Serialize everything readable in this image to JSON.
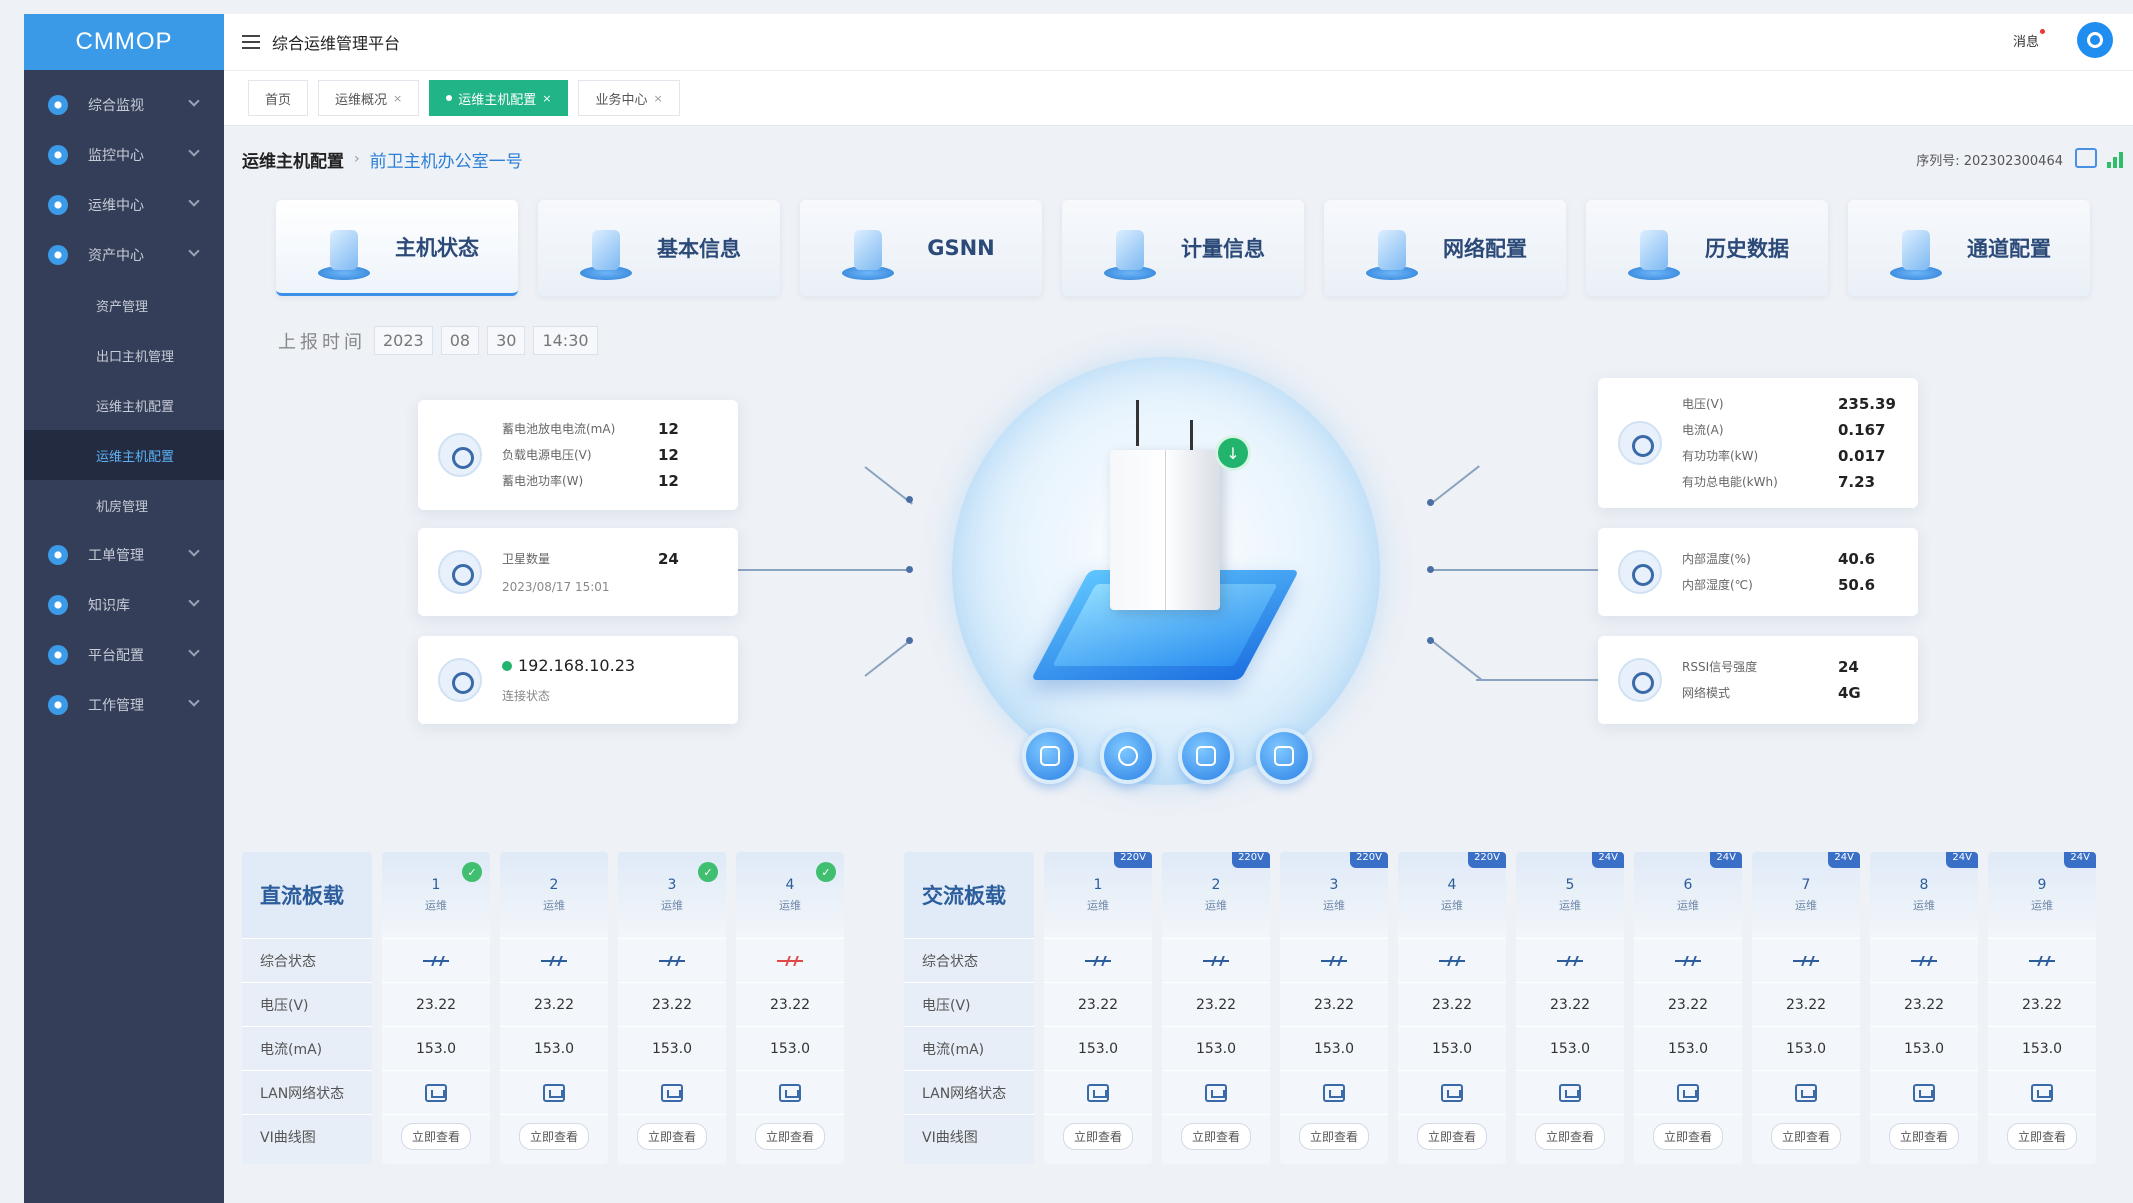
{
  "app": {
    "logo": "CMMOP",
    "platform_title": "综合运维管理平台"
  },
  "sidebar": {
    "items": [
      {
        "label": "综合监视",
        "icon": "monitor-icon"
      },
      {
        "label": "监控中心",
        "icon": "eye-icon"
      },
      {
        "label": "运维中心",
        "icon": "layers-icon"
      },
      {
        "label": "资产中心",
        "icon": "bars-icon"
      }
    ],
    "subitems": [
      {
        "label": "资产管理"
      },
      {
        "label": "出口主机管理"
      },
      {
        "label": "运维主机配置"
      },
      {
        "label": "运维主机配置",
        "active": true
      },
      {
        "label": "机房管理"
      }
    ],
    "items_after": [
      {
        "label": "工单管理",
        "icon": "gear-icon"
      },
      {
        "label": "知识库",
        "icon": "book-icon"
      },
      {
        "label": "平台配置",
        "icon": "settings-icon"
      },
      {
        "label": "工作管理",
        "icon": "work-icon"
      }
    ]
  },
  "topbar": {
    "message": "消息"
  },
  "tabs": [
    {
      "label": "首页",
      "closable": false
    },
    {
      "label": "运维概况",
      "closable": true
    },
    {
      "label": "运维主机配置",
      "closable": true,
      "active": true
    },
    {
      "label": "业务中心",
      "closable": true
    }
  ],
  "breadcrumb": {
    "main": "运维主机配置",
    "link": "前卫主机办公室一号"
  },
  "serial": {
    "label": "序列号:",
    "value": "202302300464"
  },
  "function_tabs": [
    {
      "label": "主机状态",
      "active": true
    },
    {
      "label": "基本信息"
    },
    {
      "label": "GSNN"
    },
    {
      "label": "计量信息"
    },
    {
      "label": "网络配置"
    },
    {
      "label": "历史数据"
    },
    {
      "label": "通道配置"
    }
  ],
  "report_time": {
    "label": "上报时间",
    "year": "2023",
    "month": "08",
    "day": "30",
    "time": "14:30"
  },
  "left_cards": {
    "power": {
      "rows": [
        {
          "k": "蓄电池放电电流(mA)",
          "v": "12"
        },
        {
          "k": "负载电源电压(V)",
          "v": "12"
        },
        {
          "k": "蓄电池功率(W)",
          "v": "12"
        }
      ]
    },
    "module": {
      "rows": [
        {
          "k": "卫星数量",
          "v": "24"
        }
      ],
      "sub": "2023/08/17 15:01"
    },
    "network": {
      "ip": "192.168.10.23",
      "sub": "连接状态"
    }
  },
  "right_cards": {
    "meter": {
      "rows": [
        {
          "k": "电压(V)",
          "v": "235.39"
        },
        {
          "k": "电流(A)",
          "v": "0.167"
        },
        {
          "k": "有功功率(kW)",
          "v": "0.017"
        },
        {
          "k": "有功总电能(kWh)",
          "v": "7.23"
        }
      ]
    },
    "env": {
      "rows": [
        {
          "k": "内部温度(%)",
          "v": "40.6"
        },
        {
          "k": "内部湿度(℃)",
          "v": "50.6"
        }
      ]
    },
    "signal": {
      "rows": [
        {
          "k": "RSSI信号强度",
          "v": "24"
        },
        {
          "k": "网络模式",
          "v": "4G"
        }
      ]
    }
  },
  "dc_panel": {
    "title": "直流板载",
    "row_labels": [
      "综合状态",
      "电压(V)",
      "电流(mA)",
      "LAN网络状态",
      "VI曲线图"
    ],
    "columns": [
      {
        "num": "1",
        "state": "运维",
        "badge": true,
        "voltage": "23.22",
        "current": "153.0",
        "alarm": false,
        "btn": "立即查看"
      },
      {
        "num": "2",
        "state": "运维",
        "badge": false,
        "voltage": "23.22",
        "current": "153.0",
        "alarm": false,
        "btn": "立即查看"
      },
      {
        "num": "3",
        "state": "运维",
        "badge": true,
        "voltage": "23.22",
        "current": "153.0",
        "alarm": false,
        "btn": "立即查看"
      },
      {
        "num": "4",
        "state": "运维",
        "badge": true,
        "voltage": "23.22",
        "current": "153.0",
        "alarm": true,
        "btn": "立即查看"
      }
    ]
  },
  "ac_panel": {
    "title": "交流板载",
    "row_labels": [
      "综合状态",
      "电压(V)",
      "电流(mA)",
      "LAN网络状态",
      "VI曲线图"
    ],
    "columns": [
      {
        "num": "1",
        "state": "运维",
        "tag": "220V",
        "voltage": "23.22",
        "current": "153.0",
        "btn": "立即查看"
      },
      {
        "num": "2",
        "state": "运维",
        "tag": "220V",
        "voltage": "23.22",
        "current": "153.0",
        "btn": "立即查看"
      },
      {
        "num": "3",
        "state": "运维",
        "tag": "220V",
        "voltage": "23.22",
        "current": "153.0",
        "btn": "立即查看"
      },
      {
        "num": "4",
        "state": "运维",
        "tag": "220V",
        "voltage": "23.22",
        "current": "153.0",
        "btn": "立即查看"
      },
      {
        "num": "5",
        "state": "运维",
        "tag": "24V",
        "voltage": "23.22",
        "current": "153.0",
        "btn": "立即查看"
      },
      {
        "num": "6",
        "state": "运维",
        "tag": "24V",
        "voltage": "23.22",
        "current": "153.0",
        "btn": "立即查看"
      },
      {
        "num": "7",
        "state": "运维",
        "tag": "24V",
        "voltage": "23.22",
        "current": "153.0",
        "btn": "立即查看"
      },
      {
        "num": "8",
        "state": "运维",
        "tag": "24V",
        "voltage": "23.22",
        "current": "153.0",
        "btn": "立即查看"
      },
      {
        "num": "9",
        "state": "运维",
        "tag": "24V",
        "voltage": "23.22",
        "current": "153.0",
        "btn": "立即查看"
      }
    ]
  },
  "colors": {
    "accent": "#3a9ae8",
    "active_tab": "#20b487",
    "sidebar": "#343e58",
    "online": "#22b46c",
    "alarm": "#e04848"
  }
}
